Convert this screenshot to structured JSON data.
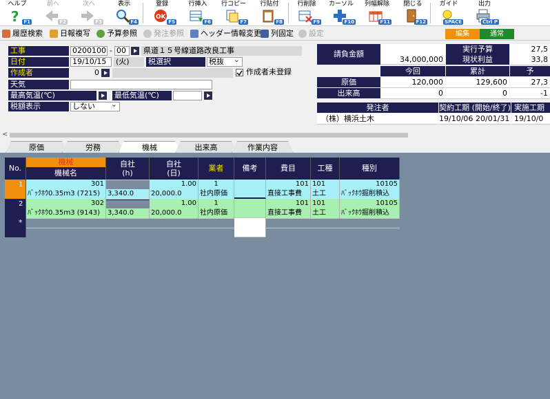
{
  "toolbar": {
    "help": "ヘルプ",
    "help_key": "F1",
    "prev": "前へ",
    "prev_key": "F2",
    "next": "次へ",
    "next_key": "F3",
    "display": "表示",
    "display_key": "F4",
    "register": "登録",
    "register_key": "F5",
    "row_insert": "行挿入",
    "row_insert_key": "F6",
    "row_copy": "行コピー",
    "row_copy_key": "F7",
    "row_paste": "行貼付",
    "row_paste_key": "F8",
    "row_delete": "行削除",
    "row_delete_key": "F9",
    "cursor": "カーソル",
    "cursor_key": "F10",
    "col_width_reset": "列幅解除",
    "col_width_reset_key": "F11",
    "close": "閉じる",
    "close_key": "F12",
    "guide": "ガイド",
    "guide_key": "SPACE",
    "output": "出力",
    "output_key": "Ctrl P"
  },
  "toolbar2": {
    "history_search": "履歴検索",
    "daily_copy": "日報複写",
    "budget_ref": "予算参照",
    "order_ref": "発注参照",
    "header_change": "ヘッダー情報変更",
    "col_fix": "列固定",
    "settings": "設定",
    "mode_edit": "編集",
    "mode_normal": "通常"
  },
  "form": {
    "koji_label": "工事",
    "koji_code": "02001001",
    "koji_sep": "-",
    "koji_branch": "00",
    "koji_name": "県道１５号線道路改良工事",
    "date_label": "日付",
    "date_value": "19/10/15",
    "date_day": "(火)",
    "tax_select_label": "税選択",
    "tax_select_value": "税抜",
    "author_label": "作成者",
    "author_value": "0",
    "author_unreg": "作成者未登録",
    "weather_label": "天気",
    "max_temp_label": "最高気温(℃)",
    "min_temp_label": "最低気温(℃)",
    "tax_display_label": "税額表示",
    "tax_display_value": "しない"
  },
  "summary": {
    "contract_label": "請負金額",
    "contract_value": "34,000,000",
    "exec_budget_label": "実行予算",
    "exec_budget_value": "27,5",
    "profit_label": "現状利益",
    "profit_value": "33,8",
    "this_time": "今回",
    "cumulative": "累計",
    "forecast": "予",
    "cost_label": "原価",
    "cost_now": "120,000",
    "cost_cum": "129,600",
    "cost_fc": "27,3",
    "progress_label": "出来高",
    "progress_now": "0",
    "progress_cum": "0",
    "progress_fc": "-1",
    "orderer_label": "発注者",
    "period_label": "契約工期 (開始/終了)",
    "actual_label": "実施工期",
    "orderer_value": "（株）横浜土木",
    "period_start": "19/10/06",
    "period_end": "20/01/31",
    "actual_start": "19/10/0"
  },
  "tabs": [
    "原価",
    "労務",
    "機械",
    "出来高",
    "作業内容"
  ],
  "grid": {
    "headers": {
      "no": "No.",
      "kikai": "機械",
      "kikai_name": "機械名",
      "jisha_h": "自社\n(h)",
      "jisha_d": "自社\n(日)",
      "vendor": "業者",
      "note": "備考",
      "himoku": "費目",
      "koshu": "工種",
      "shubetsu": "種別"
    },
    "rows": [
      {
        "no": "1",
        "code": "301",
        "name": "ﾊﾞｯｸﾎｳ0.35ｍ3 (7215)",
        "h": "3,340.0",
        "d_qty": "1.00",
        "d_amt": "20,000.0",
        "vendor_code": "1",
        "vendor_name": "社内原価",
        "himoku_code": "101",
        "himoku_name": "直接工事費",
        "koshu_code": "101",
        "koshu_name": "土工",
        "shubetsu_code": "10105",
        "shubetsu_name": "ﾊﾞｯｸﾎｳ掘削積込"
      },
      {
        "no": "2",
        "code": "302",
        "name": "ﾊﾞｯｸﾎｳ0.35ｍ3 (9143)",
        "h": "3,340.0",
        "d_qty": "1.00",
        "d_amt": "20,000.0",
        "vendor_code": "1",
        "vendor_name": "社内原価",
        "himoku_code": "101",
        "himoku_name": "直接工事費",
        "koshu_code": "101",
        "koshu_name": "土工",
        "shubetsu_code": "10105",
        "shubetsu_name": "ﾊﾞｯｸﾎｳ掘削積込"
      }
    ],
    "new_row_marker": "*"
  },
  "colors": {
    "header_bg": "#1e1e50",
    "label_yellow": "#f0e000",
    "row_cyan": "#a8f0f8",
    "row_green": "#a8f0b0",
    "grid_bg": "#7a8ca0",
    "accent_orange": "#f0900c"
  }
}
